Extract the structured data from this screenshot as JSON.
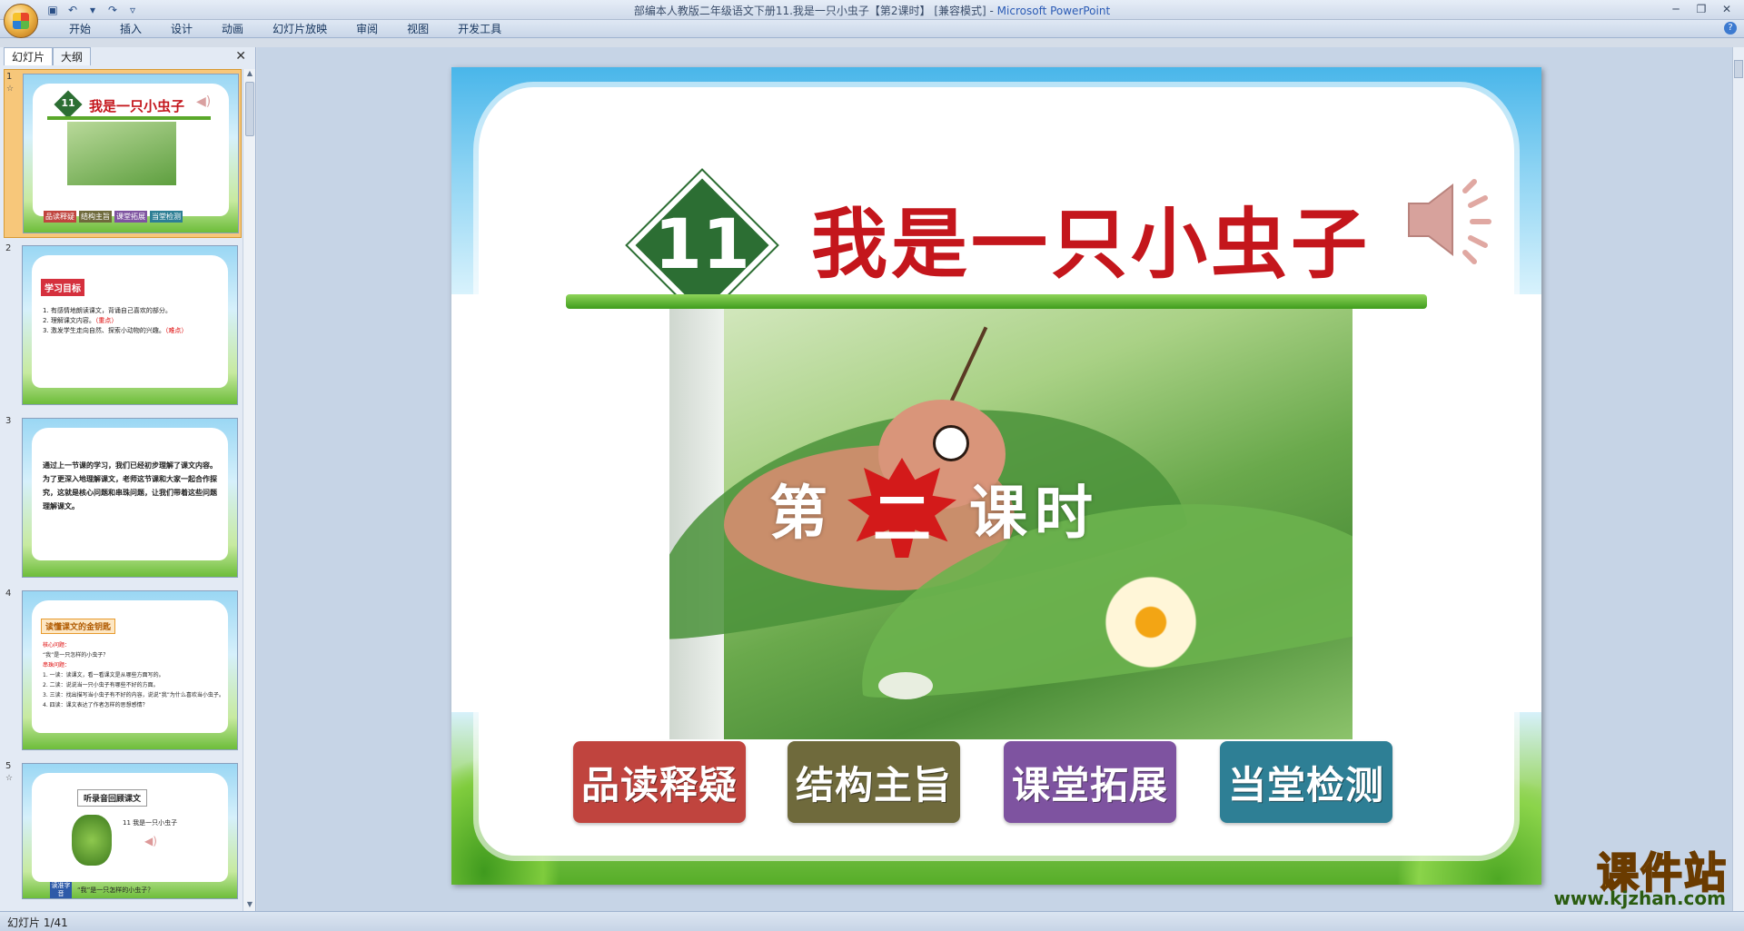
{
  "window": {
    "title": "部编本人教版二年级语文下册11.我是一只小虫子【第2课时】 [兼容模式] - ",
    "app_name": "Microsoft PowerPoint"
  },
  "ribbon": {
    "tabs": [
      "开始",
      "插入",
      "设计",
      "动画",
      "幻灯片放映",
      "审阅",
      "视图",
      "开发工具"
    ]
  },
  "left_panel": {
    "tabs": [
      "幻灯片",
      "大纲"
    ],
    "thumbnails": [
      {
        "number": "1",
        "title": "我是一只小虫子",
        "num_badge": "11",
        "buttons": [
          "品读释疑",
          "结构主旨",
          "课堂拓展",
          "当堂检测"
        ]
      },
      {
        "number": "2",
        "heading": "学习目标",
        "lines": [
          "1. 有感情地朗读课文，背诵自己喜欢的部分。",
          "2. 理解课文内容。",
          "3. 激发学生走向自然、探索小动物的兴趣。"
        ],
        "tags": [
          "（重点）",
          "（难点）"
        ]
      },
      {
        "number": "3",
        "text": "通过上一节课的学习，我们已经初步理解了课文内容。为了更深入地理解课文，老师这节课和大家一起合作探究，这就是核心问题和串珠问题，让我们带着这些问题理解课文。"
      },
      {
        "number": "4",
        "heading": "读懂课文的金钥匙",
        "lines": [
          "核心问题：",
          "“我”是一只怎样的小虫子？",
          "串珠问题：",
          "1. 一读：读课文，看一看课文是从哪些方面写的。",
          "2. 二读：说说当一只小虫子有哪些不好的方面。",
          "3. 三读：找出描写当小虫子有不好的内容，说说“我”为什么喜欢当小虫子。",
          "4. 四读：课文表达了作者怎样的思想感情？"
        ]
      },
      {
        "number": "5",
        "heading": "听录音回顾课文",
        "caption": "11  我是一只小虫子",
        "side": "读准字音",
        "question": "“我”是一只怎样的小虫子？"
      }
    ]
  },
  "slide": {
    "number_badge": "11",
    "title": "我是一只小虫子",
    "lesson_prefix": "第",
    "lesson_number": "二",
    "lesson_suffix": "课时",
    "buttons": [
      {
        "label": "品读释疑",
        "color": "#c0443e"
      },
      {
        "label": "结构主旨",
        "color": "#6f6a3c"
      },
      {
        "label": "课堂拓展",
        "color": "#7e53a0"
      },
      {
        "label": "当堂检测",
        "color": "#2e7f95"
      }
    ]
  },
  "statusbar": {
    "text": "幻灯片 1/41"
  },
  "watermark": {
    "brand": "课件站",
    "url": "www.kjzhan.com"
  },
  "colors": {
    "title_red": "#c4161c",
    "badge_green": "#2c6e33",
    "selected_thumb": "#f7c77a"
  }
}
